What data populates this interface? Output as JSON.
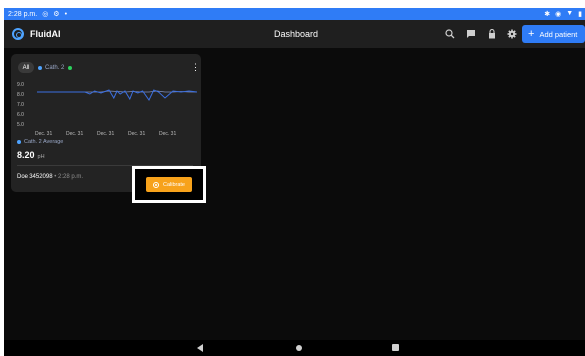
{
  "status_bar": {
    "time": "2:28 p.m.",
    "icons": [
      "sync-icon",
      "settings-icon",
      "dot-icon"
    ],
    "right_icons": [
      "bluetooth-icon",
      "location-icon",
      "wifi-icon",
      "battery-icon"
    ]
  },
  "app_bar": {
    "app_name": "FluidAI",
    "page_title": "Dashboard",
    "icons": [
      "search-icon",
      "message-icon",
      "lock-icon",
      "gear-icon"
    ],
    "add_patient_label": "Add patient",
    "accent": "#2f7cf6"
  },
  "card": {
    "filter_all": "All",
    "filter_cath": "Cath. 2",
    "y_ticks": [
      "9.0",
      "8.0",
      "7.0",
      "6.0",
      "5.0"
    ],
    "x_ticks": [
      "Dec. 31",
      "Dec. 31",
      "Dec. 31",
      "Dec. 31",
      "Dec. 31"
    ],
    "legend": "Cath. 2 Average",
    "reading_value": "8.20",
    "reading_unit": "pH",
    "patient_id": "Doe 3452098",
    "patient_time": " • 2:28 p.m.",
    "calibrate_label": "Calibrate",
    "calibrate_color": "#f7a21b"
  },
  "chart_data": {
    "type": "line",
    "title": "",
    "xlabel": "",
    "ylabel": "",
    "ylim": [
      5.0,
      9.0
    ],
    "x_tick_labels": [
      "Dec. 31",
      "Dec. 31",
      "Dec. 31",
      "Dec. 31",
      "Dec. 31"
    ],
    "series": [
      {
        "name": "Cath. 2 Average",
        "color": "#3b6fe0",
        "x": [
          0,
          0.05,
          0.1,
          0.15,
          0.2,
          0.25,
          0.3,
          0.33,
          0.36,
          0.4,
          0.45,
          0.48,
          0.5,
          0.52,
          0.55,
          0.58,
          0.6,
          0.63,
          0.66,
          0.7,
          0.73,
          0.76,
          0.8,
          0.85,
          0.9,
          0.95,
          1.0
        ],
        "values": [
          8.2,
          8.2,
          8.2,
          8.2,
          8.2,
          8.2,
          8.2,
          8.0,
          8.3,
          8.1,
          8.4,
          7.6,
          8.3,
          8.0,
          8.3,
          7.5,
          8.3,
          8.1,
          8.3,
          7.4,
          8.4,
          8.2,
          7.6,
          8.3,
          8.2,
          8.3,
          8.2
        ]
      },
      {
        "name": "",
        "color": "#7f8fbf",
        "x": [
          0,
          0.05,
          0.1,
          0.15,
          0.2,
          0.25,
          0.3,
          0.35,
          0.4,
          0.45,
          0.5,
          0.55,
          0.6,
          0.65,
          0.7,
          0.75,
          0.8,
          0.85,
          0.9,
          0.95,
          1.0
        ],
        "values": [
          8.2,
          8.2,
          8.2,
          8.2,
          8.2,
          8.2,
          8.2,
          8.2,
          8.2,
          8.3,
          8.25,
          8.2,
          8.25,
          8.2,
          8.2,
          8.3,
          8.2,
          8.2,
          8.25,
          8.2,
          8.2
        ]
      }
    ],
    "grid": false,
    "legend_position": "bottom-left"
  },
  "nav_bar": {
    "icons": [
      "back-icon",
      "home-icon",
      "recent-apps-icon"
    ]
  }
}
